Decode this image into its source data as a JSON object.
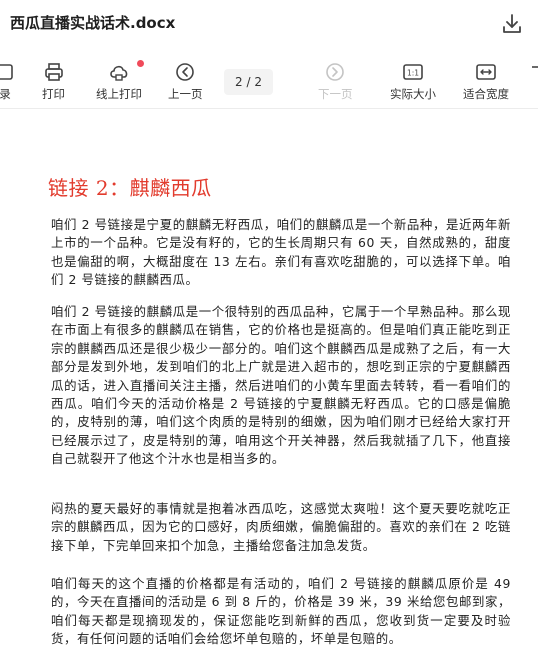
{
  "document": {
    "file_name": "西瓜直播实战话术.docx"
  },
  "toolbar": {
    "items": [
      {
        "label": "录",
        "icon": "catalog-icon"
      },
      {
        "label": "打印",
        "icon": "printer-icon"
      },
      {
        "label": "线上打印",
        "icon": "cloud-print-icon"
      },
      {
        "label": "上一页",
        "icon": "prev-page-icon"
      },
      {
        "label": "下一页",
        "icon": "next-page-icon"
      },
      {
        "label": "实际大小",
        "icon": "actual-size-icon"
      },
      {
        "label": "适合宽度",
        "icon": "fit-width-icon"
      }
    ],
    "page_indicator": "2 / 2",
    "actual_size_icon_text": "1:1"
  },
  "content": {
    "heading": "链接 2：麒麟西瓜",
    "paragraphs": [
      "  咱们 2 号链接是宁夏的麒麟无籽西瓜，咱们的麒麟瓜是一个新品种，是近两年新上市的一个品种。它是没有籽的，它的生长周期只有 60 天，自然成熟的，甜度也是偏甜的啊，大概甜度在 13 左右。亲们有喜欢吃甜脆的，可以选择下单。咱们 2 号链接的麒麟西瓜。",
      "  咱们 2 号链接的麒麟瓜是一个很特别的西瓜品种，它属于一个早熟品种。那么现在市面上有很多的麒麟瓜在销售，它的价格也是挺高的。但是咱们真正能吃到正宗的麒麟西瓜还是很少极少一部分的。咱们这个麒麟西瓜是成熟了之后，有一大部分是发到外地，发到咱们的北上广就是进入超市的，想吃到正宗的宁夏麒麟西瓜的话，进入直播间关注主播，然后进咱们的小黄车里面去转转，看一看咱们的西瓜。咱们今天的活动价格是 2 号链接的宁夏麒麟无籽西瓜。它的口感是偏脆的，皮特别的薄，咱们这个肉质的是特别的细嫩，因为咱们刚才已经给大家打开已经展示过了，皮是特别的薄，咱用这个开关神器，然后我就插了几下，他直接自己就裂开了他这个汁水也是相当多的。",
      "闷热的夏天最好的事情就是抱着冰西瓜吃，这感觉太爽啦！这个夏天要吃就吃正宗的麒麟西瓜，因为它的口感好，肉质细嫩，偏脆偏甜的。喜欢的亲们在 2 吃链接下单，下完单回来扣个加急，主播给您备注加急发货。",
      "咱们每天的这个直播的价格都是有活动的，咱们 2 号链接的麒麟瓜原价是 49 的，今天在直播间的活动是 6 到 8 斤的，价格是 39 米，39 米给您包邮到家，咱们每天都是现摘现发的，保证您能吃到新鲜的西瓜，您收到货一定要及时验货，有任何问题的话咱们会给您坏单包赔的，坏单是包赔的。"
    ]
  },
  "colors": {
    "heading": "#e23b2d",
    "badge": "#f04a5a",
    "disabled": "#c4c4c4"
  }
}
